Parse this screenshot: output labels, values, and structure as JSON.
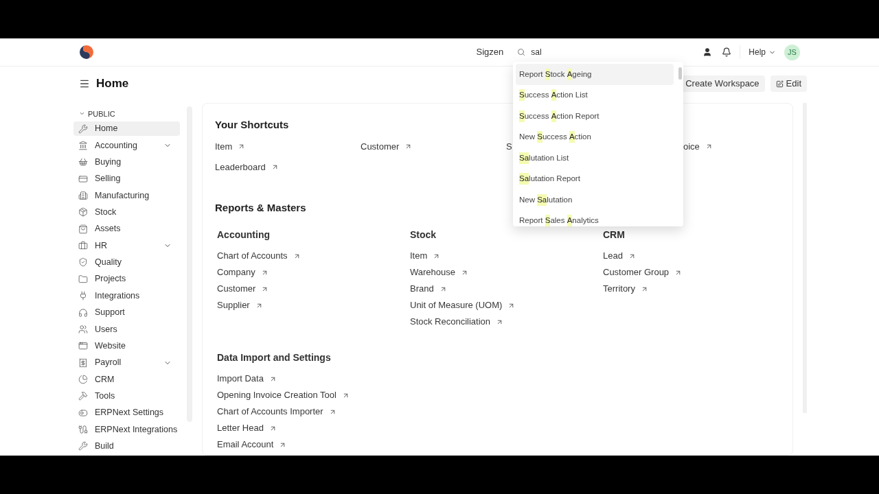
{
  "navbar": {
    "company": "Sigzen",
    "search": {
      "value": "sal"
    },
    "help": "Help",
    "avatar": "JS"
  },
  "search_results": [
    {
      "selected": true,
      "parts": [
        {
          "text": "Report ",
          "highlight": false
        },
        {
          "text": "S",
          "highlight": true
        },
        {
          "text": "tock ",
          "highlight": false
        },
        {
          "text": "A",
          "highlight": true
        },
        {
          "text": "geing",
          "highlight": false
        }
      ]
    },
    {
      "selected": false,
      "parts": [
        {
          "text": "S",
          "highlight": true
        },
        {
          "text": "uccess ",
          "highlight": false
        },
        {
          "text": "A",
          "highlight": true
        },
        {
          "text": "ction List",
          "highlight": false
        }
      ]
    },
    {
      "selected": false,
      "parts": [
        {
          "text": "S",
          "highlight": true
        },
        {
          "text": "uccess ",
          "highlight": false
        },
        {
          "text": "A",
          "highlight": true
        },
        {
          "text": "ction Report",
          "highlight": false
        }
      ]
    },
    {
      "selected": false,
      "parts": [
        {
          "text": "New ",
          "highlight": false
        },
        {
          "text": "S",
          "highlight": true
        },
        {
          "text": "uccess ",
          "highlight": false
        },
        {
          "text": "A",
          "highlight": true
        },
        {
          "text": "ction",
          "highlight": false
        }
      ]
    },
    {
      "selected": false,
      "parts": [
        {
          "text": "Sa",
          "highlight": true
        },
        {
          "text": "lutation List",
          "highlight": false
        }
      ]
    },
    {
      "selected": false,
      "parts": [
        {
          "text": "Sa",
          "highlight": true
        },
        {
          "text": "lutation Report",
          "highlight": false
        }
      ]
    },
    {
      "selected": false,
      "parts": [
        {
          "text": "New ",
          "highlight": false
        },
        {
          "text": "Sa",
          "highlight": true
        },
        {
          "text": "lutation",
          "highlight": false
        }
      ]
    },
    {
      "selected": false,
      "parts": [
        {
          "text": "Report ",
          "highlight": false
        },
        {
          "text": "S",
          "highlight": true
        },
        {
          "text": "ales ",
          "highlight": false
        },
        {
          "text": "A",
          "highlight": true
        },
        {
          "text": "nalytics",
          "highlight": false
        }
      ]
    }
  ],
  "page": {
    "title": "Home",
    "buttons": [
      "Create Workspace",
      "Edit"
    ]
  },
  "sidebar": {
    "section": "PUBLIC",
    "expanded": true,
    "items": [
      {
        "label": "Home",
        "selected": true,
        "expandable": false
      },
      {
        "label": "Accounting",
        "selected": false,
        "expandable": true
      },
      {
        "label": "Buying",
        "selected": false,
        "expandable": false
      },
      {
        "label": "Selling",
        "selected": false,
        "expandable": false
      },
      {
        "label": "Manufacturing",
        "selected": false,
        "expandable": false
      },
      {
        "label": "Stock",
        "selected": false,
        "expandable": false
      },
      {
        "label": "Assets",
        "selected": false,
        "expandable": false
      },
      {
        "label": "HR",
        "selected": false,
        "expandable": true
      },
      {
        "label": "Quality",
        "selected": false,
        "expandable": false
      },
      {
        "label": "Projects",
        "selected": false,
        "expandable": false
      },
      {
        "label": "Integrations",
        "selected": false,
        "expandable": false
      },
      {
        "label": "Support",
        "selected": false,
        "expandable": false
      },
      {
        "label": "Users",
        "selected": false,
        "expandable": false
      },
      {
        "label": "Website",
        "selected": false,
        "expandable": false
      },
      {
        "label": "Payroll",
        "selected": false,
        "expandable": true
      },
      {
        "label": "CRM",
        "selected": false,
        "expandable": false
      },
      {
        "label": "Tools",
        "selected": false,
        "expandable": false
      },
      {
        "label": "ERPNext Settings",
        "selected": false,
        "expandable": false
      },
      {
        "label": "ERPNext Integrations",
        "selected": false,
        "expandable": false
      },
      {
        "label": "Build",
        "selected": false,
        "expandable": false
      }
    ]
  },
  "shortcuts": {
    "title": "Your Shortcuts",
    "items": [
      "Item",
      "Customer",
      "S",
      "oice",
      "Leaderboard"
    ]
  },
  "reports": {
    "title": "Reports & Masters",
    "groups": [
      {
        "title": "Accounting",
        "links": [
          "Chart of Accounts",
          "Company",
          "Customer",
          "Supplier"
        ]
      },
      {
        "title": "Stock",
        "links": [
          "Item",
          "Warehouse",
          "Brand",
          "Unit of Measure (UOM)",
          "Stock Reconciliation"
        ]
      },
      {
        "title": "CRM",
        "links": [
          "Lead",
          "Customer Group",
          "Territory"
        ]
      }
    ]
  },
  "data_import": {
    "title": "Data Import and Settings",
    "links": [
      "Import Data",
      "Opening Invoice Creation Tool",
      "Chart of Accounts Importer",
      "Letter Head",
      "Email Account"
    ]
  }
}
